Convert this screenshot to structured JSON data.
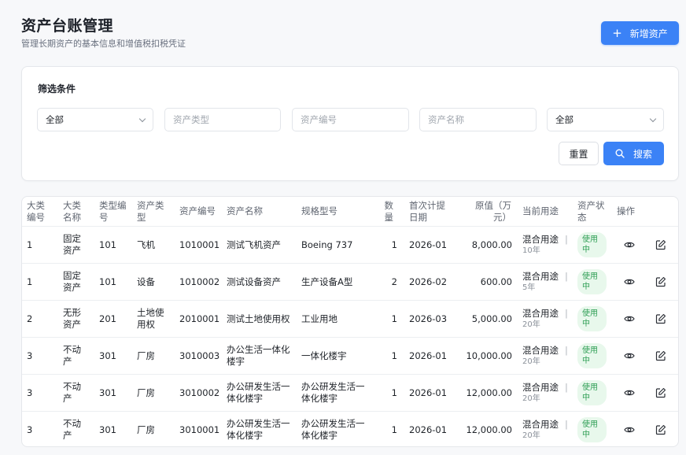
{
  "header": {
    "title": "资产台账管理",
    "subtitle": "管理长期资产的基本信息和增值税扣税凭证",
    "add_button": "新增资产"
  },
  "filters": {
    "title": "筛选条件",
    "category_select": "全部",
    "type_placeholder": "资产类型",
    "code_placeholder": "资产编号",
    "name_placeholder": "资产名称",
    "status_select": "全部",
    "reset_button": "重置",
    "search_button": "搜索"
  },
  "table": {
    "columns": [
      "大类编号",
      "大类名称",
      "类型编号",
      "资产类型",
      "资产编号",
      "资产名称",
      "规格型号",
      "数量",
      "首次计提日期",
      "原值（万元）",
      "当前用途",
      "资产状态",
      "操作"
    ],
    "rows": [
      {
        "cat_code": "1",
        "cat_name": "固定资产",
        "type_code": "101",
        "type": "飞机",
        "code": "1010001",
        "name": "测试飞机资产",
        "spec": "Boeing 737",
        "qty": "1",
        "date": "2026-01",
        "value": "8,000.00",
        "usage": "混合用途",
        "years": "10年",
        "status": "使用中"
      },
      {
        "cat_code": "1",
        "cat_name": "固定资产",
        "type_code": "101",
        "type": "设备",
        "code": "1010002",
        "name": "测试设备资产",
        "spec": "生产设备A型",
        "qty": "2",
        "date": "2026-02",
        "value": "600.00",
        "usage": "混合用途",
        "years": "5年",
        "status": "使用中"
      },
      {
        "cat_code": "2",
        "cat_name": "无形资产",
        "type_code": "201",
        "type": "土地使用权",
        "code": "2010001",
        "name": "测试土地使用权",
        "spec": "工业用地",
        "qty": "1",
        "date": "2026-03",
        "value": "5,000.00",
        "usage": "混合用途",
        "years": "20年",
        "status": "使用中"
      },
      {
        "cat_code": "3",
        "cat_name": "不动产",
        "type_code": "301",
        "type": "厂房",
        "code": "3010003",
        "name": "办公生活一体化楼宇",
        "spec": "一体化楼宇",
        "qty": "1",
        "date": "2026-01",
        "value": "10,000.00",
        "usage": "混合用途",
        "years": "20年",
        "status": "使用中"
      },
      {
        "cat_code": "3",
        "cat_name": "不动产",
        "type_code": "301",
        "type": "厂房",
        "code": "3010002",
        "name": "办公研发生活一体化楼宇",
        "spec": "办公研发生活一体化楼宇",
        "qty": "1",
        "date": "2026-01",
        "value": "12,000.00",
        "usage": "混合用途",
        "years": "20年",
        "status": "使用中"
      },
      {
        "cat_code": "3",
        "cat_name": "不动产",
        "type_code": "301",
        "type": "厂房",
        "code": "3010001",
        "name": "办公研发生活一体化楼宇",
        "spec": "办公研发生活一体化楼宇",
        "qty": "1",
        "date": "2026-01",
        "value": "12,000.00",
        "usage": "混合用途",
        "years": "20年",
        "status": "使用中"
      }
    ]
  },
  "colors": {
    "primary": "#3b82f6",
    "badge_bg": "#e8f8ec",
    "badge_text": "#2e9e54"
  }
}
